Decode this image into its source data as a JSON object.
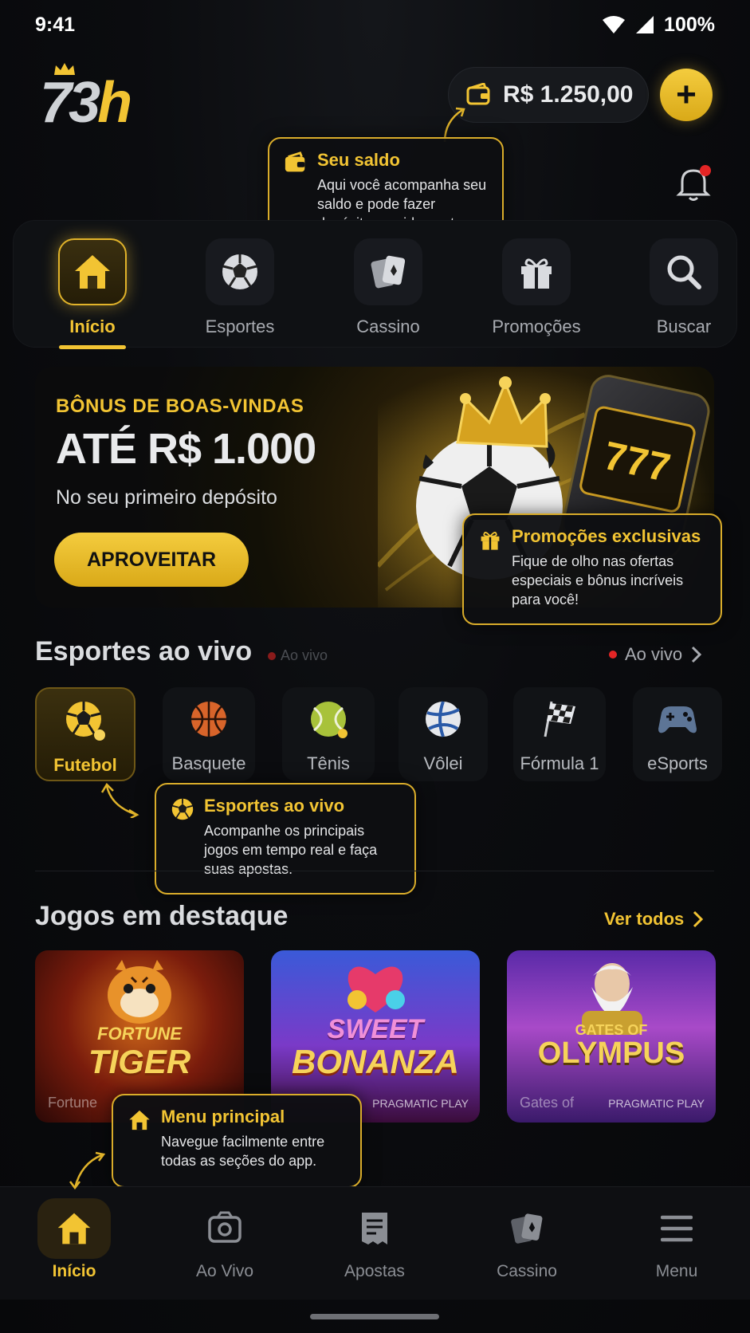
{
  "status_bar": {
    "time": "9:41",
    "battery": "100%"
  },
  "header": {
    "logo": "73h",
    "balance": "R$ 1.250,00",
    "add_label": "+"
  },
  "tooltips": {
    "balance": {
      "title": "Seu saldo",
      "body": "Aqui você acompanha seu saldo e pode fazer depósitos rapidamente."
    },
    "promos": {
      "title": "Promoções exclusivas",
      "body": "Fique de olho nas ofertas especiais e bônus incríveis para você!"
    },
    "live": {
      "title": "Esportes ao vivo",
      "body": "Acompanhe os principais jogos em tempo real e faça suas apostas."
    },
    "menu": {
      "title": "Menu principal",
      "body": "Navegue facilmente entre todas as seções do app."
    }
  },
  "categories": [
    {
      "label": "Início",
      "icon": "home-icon",
      "active": true
    },
    {
      "label": "Esportes",
      "icon": "soccer-ball-icon",
      "active": false
    },
    {
      "label": "Cassino",
      "icon": "cards-icon",
      "active": false
    },
    {
      "label": "Promoções",
      "icon": "gift-icon",
      "active": false
    },
    {
      "label": "Buscar",
      "icon": "search-icon",
      "active": false
    }
  ],
  "banner": {
    "kicker": "BÔNUS DE BOAS-VINDAS",
    "title": "ATÉ R$ 1.000",
    "subtitle": "No seu primeiro depósito",
    "cta": "APROVEITAR",
    "slot_digits": "777"
  },
  "live_section": {
    "title": "Esportes ao vivo",
    "ghost": "Ao vivo",
    "link": "Ao vivo",
    "sports": [
      {
        "label": "Futebol",
        "icon": "soccer-ball-icon",
        "active": true
      },
      {
        "label": "Basquete",
        "icon": "basketball-icon",
        "active": false
      },
      {
        "label": "Tênis",
        "icon": "tennis-ball-icon",
        "active": false
      },
      {
        "label": "Vôlei",
        "icon": "volleyball-icon",
        "active": false
      },
      {
        "label": "Fórmula 1",
        "icon": "checkered-flag-icon",
        "active": false
      },
      {
        "label": "eSports",
        "icon": "gamepad-icon",
        "active": false
      }
    ]
  },
  "games_section": {
    "title": "Jogos em destaque",
    "link": "Ver todos",
    "games": [
      {
        "title": "TIGER",
        "pretitle": "FORTUNE",
        "footer": "Fortune",
        "provider": ""
      },
      {
        "title": "BONANZA",
        "pretitle": "SWEET",
        "footer": "",
        "provider": "PRAGMATIC PLAY"
      },
      {
        "title": "OLYMPUS",
        "pretitle": "GATES OF",
        "footer": "Gates of",
        "provider": "PRAGMATIC PLAY"
      }
    ]
  },
  "bottom_nav": [
    {
      "label": "Início",
      "icon": "home-icon",
      "active": true
    },
    {
      "label": "Ao Vivo",
      "icon": "live-camera-icon",
      "active": false
    },
    {
      "label": "Apostas",
      "icon": "ticket-icon",
      "active": false
    },
    {
      "label": "Cassino",
      "icon": "cards-icon",
      "active": false
    },
    {
      "label": "Menu",
      "icon": "menu-icon",
      "active": false
    }
  ],
  "colors": {
    "accent": "#f2c433",
    "background": "#08090b",
    "panel": "#0f1114"
  }
}
